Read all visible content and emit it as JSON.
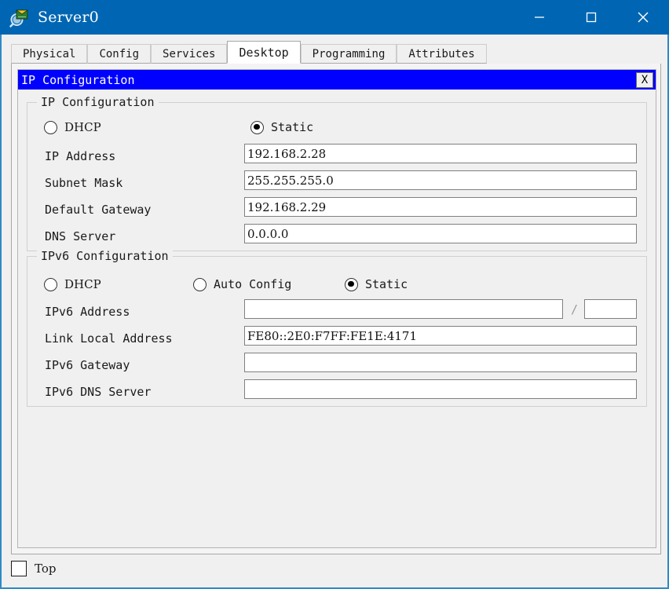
{
  "window": {
    "title": "Server0",
    "icon": "packet-tracer-server-icon",
    "controls": {
      "minimize": "minimize-icon",
      "maximize": "maximize-icon",
      "close": "close-icon"
    },
    "titlebar_color": "#0066b3"
  },
  "tabs": [
    {
      "label": "Physical",
      "active": false
    },
    {
      "label": "Config",
      "active": false
    },
    {
      "label": "Services",
      "active": false
    },
    {
      "label": "Desktop",
      "active": true
    },
    {
      "label": "Programming",
      "active": false
    },
    {
      "label": "Attributes",
      "active": false
    }
  ],
  "dialog": {
    "title": "IP Configuration",
    "close_label": "X",
    "titlebar_color": "#0000ff",
    "ipv4": {
      "legend": "IP Configuration",
      "mode_options": [
        {
          "label": "DHCP",
          "selected": false
        },
        {
          "label": "Static",
          "selected": true
        }
      ],
      "fields": [
        {
          "label": "IP Address",
          "value": "192.168.2.28"
        },
        {
          "label": "Subnet Mask",
          "value": "255.255.255.0"
        },
        {
          "label": "Default Gateway",
          "value": "192.168.2.29"
        },
        {
          "label": "DNS Server",
          "value": "0.0.0.0"
        }
      ]
    },
    "ipv6": {
      "legend": "IPv6 Configuration",
      "mode_options": [
        {
          "label": "DHCP",
          "selected": false
        },
        {
          "label": "Auto Config",
          "selected": false
        },
        {
          "label": "Static",
          "selected": true
        }
      ],
      "address": {
        "label": "IPv6 Address",
        "value": "",
        "separator": "/",
        "prefix_value": ""
      },
      "fields": [
        {
          "label": "Link Local Address",
          "value": "FE80::2E0:F7FF:FE1E:4171"
        },
        {
          "label": "IPv6 Gateway",
          "value": ""
        },
        {
          "label": "IPv6 DNS Server",
          "value": ""
        }
      ]
    }
  },
  "footer": {
    "top_checkbox": {
      "label": "Top",
      "checked": false
    }
  }
}
